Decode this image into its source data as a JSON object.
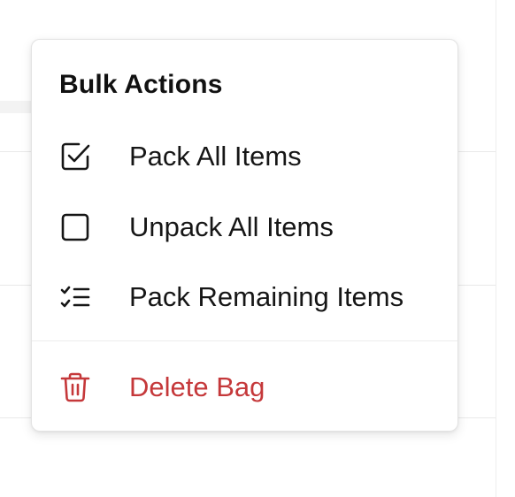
{
  "menu": {
    "title": "Bulk Actions",
    "items": [
      {
        "label": "Pack All Items",
        "icon": "checkbox-checked-icon"
      },
      {
        "label": "Unpack All Items",
        "icon": "checkbox-empty-icon"
      },
      {
        "label": "Pack Remaining Items",
        "icon": "checklist-icon"
      },
      {
        "label": "Delete Bag",
        "icon": "trash-icon"
      }
    ]
  },
  "colors": {
    "text": "#161616",
    "danger": "#c5383a",
    "border": "#e3e3e3"
  }
}
